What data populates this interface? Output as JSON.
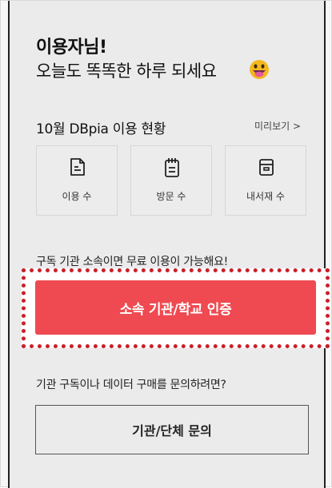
{
  "greeting": {
    "name_line": "이용자님!",
    "message": "오늘도 똑똑한 하루 되세요"
  },
  "usage": {
    "title": "10월 DBpia 이용 현황",
    "preview_link": "미리보기 >",
    "cards": [
      {
        "label": "이용 수",
        "icon": "document-icon"
      },
      {
        "label": "방문 수",
        "icon": "notepad-icon"
      },
      {
        "label": "내서재 수",
        "icon": "archive-box-icon"
      }
    ]
  },
  "subscription": {
    "notice": "구독 기관 소속이면 무료 이용이 가능해요!",
    "verify_button": "소속 기관/학교 인증"
  },
  "contact": {
    "question": "기관 구독이나 데이터 구매를 문의하려면?",
    "button": "기관/단체 문의"
  },
  "colors": {
    "accent_red": "#ef4a51",
    "highlight_border": "#c8202a",
    "panel_bg": "#ebebeb"
  }
}
